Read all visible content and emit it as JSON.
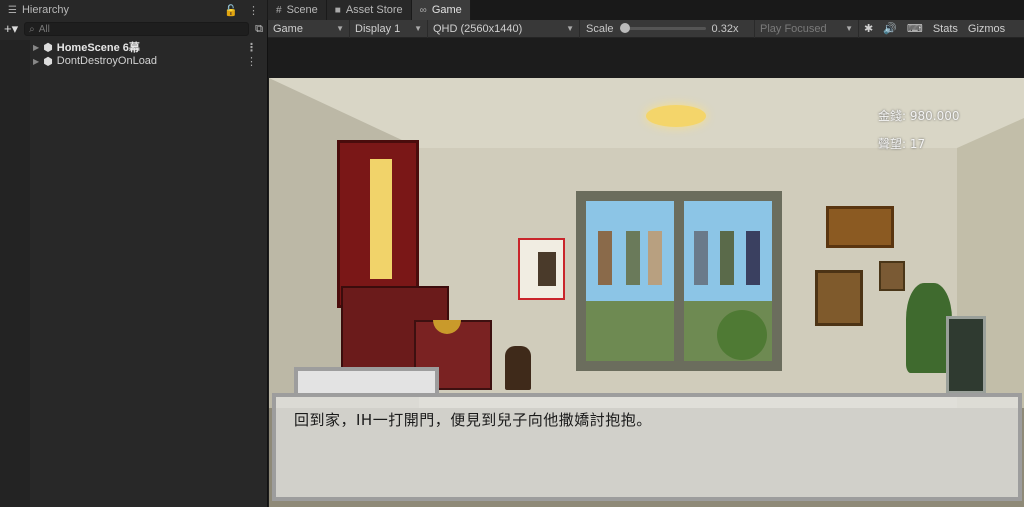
{
  "tabs": {
    "hierarchy": "Hierarchy",
    "scene": "Scene",
    "asset_store": "Asset Store",
    "game": "Game"
  },
  "hierarchy": {
    "search_placeholder": "All",
    "items": [
      {
        "label": "HomeScene 6幕"
      },
      {
        "label": "DontDestroyOnLoad"
      }
    ]
  },
  "game_toolbar": {
    "view_mode": "Game",
    "display": "Display 1",
    "resolution": "QHD (2560x1440)",
    "scale_label": "Scale",
    "scale_value": "0.32x",
    "play_mode": "Play Focused",
    "stats": "Stats",
    "gizmos": "Gizmos"
  },
  "scale_fraction": 0.0,
  "game_hud": {
    "money": "金錢: 980.000",
    "reputation": "聲望: 17"
  },
  "dialog": {
    "speaker": "",
    "text": "回到家，IH一打開門，便見到兒子向他撒嬌討抱抱。"
  },
  "colors": {
    "editor_bg": "#282828",
    "toolbar_bg": "#383838",
    "active_tab": "#3c3c3c",
    "lamp": "#f4d56a",
    "dialog_border": "#9d9d9d"
  }
}
